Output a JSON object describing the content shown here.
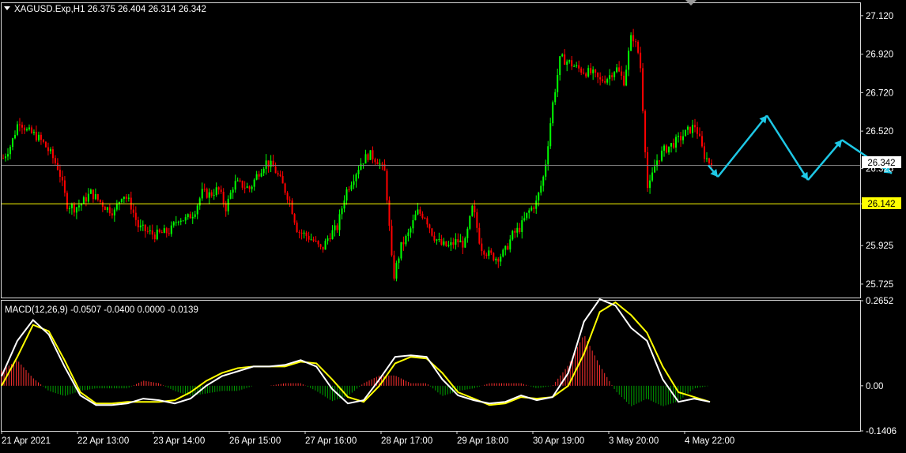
{
  "main_panel": {
    "header": "XAGUSD.Exp,H1  26.375 26.404 26.314 26.342",
    "current_price_label": "26.342",
    "level_label": "26.142",
    "colors": {
      "background": "#000000",
      "bull_candle": "#00ff00",
      "bear_candle": "#ff0000",
      "level_line": "#ffff00",
      "bid_line": "#808080",
      "arrows": "#1ec8e6",
      "axis_text": "#ffffff"
    }
  },
  "macd_panel": {
    "header": "MACD(12,26,9) -0.0507 -0.0400 0.0000 -0.0139",
    "colors": {
      "macd_line": "#ffffff",
      "signal_line": "#ffff00",
      "hist_positive": "#ff3030",
      "hist_negative": "#00a000"
    }
  },
  "chart_data": [
    {
      "type": "candlestick",
      "symbol": "XAGUSD.Exp",
      "timeframe": "H1",
      "ohlc_last": {
        "open": 26.375,
        "high": 26.404,
        "low": 26.314,
        "close": 26.342
      },
      "y_ticks": [
        "27.120",
        "26.920",
        "26.720",
        "26.520",
        "26.325",
        "26.142",
        "25.925",
        "25.725"
      ],
      "ylim": [
        25.655,
        27.185
      ],
      "horizontal_level": 26.142,
      "current_price": 26.342,
      "x_ticks": [
        "21 Apr 2021",
        "22 Apr 13:00",
        "23 Apr 14:00",
        "26 Apr 15:00",
        "27 Apr 16:00",
        "28 Apr 17:00",
        "29 Apr 18:00",
        "30 Apr 19:00",
        "3 May 20:00",
        "4 May 22:00"
      ],
      "close_path": [
        26.38,
        26.45,
        26.58,
        26.52,
        26.5,
        26.46,
        26.4,
        26.32,
        26.14,
        26.12,
        26.15,
        26.2,
        26.16,
        26.12,
        26.1,
        26.2,
        26.14,
        26.02,
        26.0,
        25.98,
        25.99,
        26.0,
        26.07,
        26.06,
        26.1,
        26.2,
        26.19,
        26.22,
        26.12,
        26.25,
        26.24,
        26.22,
        26.3,
        26.36,
        26.33,
        26.25,
        26.16,
        26.0,
        25.98,
        25.95,
        25.9,
        25.98,
        26.02,
        26.2,
        26.28,
        26.36,
        26.4,
        26.37,
        26.3,
        25.75,
        25.92,
        25.99,
        26.1,
        26.08,
        25.98,
        25.93,
        25.92,
        25.95,
        25.93,
        26.13,
        25.92,
        25.88,
        25.86,
        25.89,
        25.98,
        26.02,
        26.1,
        26.15,
        26.3,
        26.65,
        26.9,
        26.88,
        26.85,
        26.83,
        26.82,
        26.78,
        26.8,
        26.85,
        26.78,
        27.03,
        26.9,
        26.2,
        26.36,
        26.42,
        26.45,
        26.48,
        26.52,
        26.55,
        26.4,
        26.342
      ],
      "forecast_arrows": [
        [
          26.342,
          26.282
        ],
        [
          26.282,
          26.601
        ],
        [
          26.601,
          26.266
        ],
        [
          26.266,
          26.474
        ],
        [
          26.474,
          26.3
        ]
      ]
    },
    {
      "type": "macd",
      "params": "12,26,9",
      "values_shown": [
        -0.0507,
        -0.04,
        0.0,
        -0.0139
      ],
      "y_ticks": [
        "0.2652",
        "0.00",
        "-0.1406"
      ],
      "ylim": [
        -0.1406,
        0.2652
      ],
      "macd_series": [
        0.03,
        0.14,
        0.205,
        0.16,
        0.06,
        -0.03,
        -0.06,
        -0.06,
        -0.055,
        -0.04,
        -0.045,
        -0.055,
        -0.04,
        0.0,
        0.03,
        0.045,
        0.06,
        0.06,
        0.065,
        0.08,
        0.06,
        -0.01,
        -0.055,
        -0.045,
        0.02,
        0.09,
        0.095,
        0.09,
        0.02,
        -0.03,
        -0.045,
        -0.055,
        -0.05,
        -0.03,
        -0.045,
        -0.035,
        0.04,
        0.2,
        0.27,
        0.25,
        0.18,
        0.14,
        0.02,
        -0.05,
        -0.04,
        -0.05
      ],
      "signal_series": [
        0.0,
        0.09,
        0.19,
        0.17,
        0.08,
        -0.02,
        -0.055,
        -0.055,
        -0.05,
        -0.05,
        -0.05,
        -0.045,
        -0.02,
        0.015,
        0.04,
        0.055,
        0.06,
        0.06,
        0.06,
        0.075,
        0.07,
        0.02,
        -0.035,
        -0.05,
        0.0,
        0.07,
        0.09,
        0.085,
        0.04,
        -0.02,
        -0.04,
        -0.06,
        -0.055,
        -0.035,
        -0.04,
        -0.035,
        0.0,
        0.1,
        0.23,
        0.26,
        0.22,
        0.165,
        0.06,
        -0.02,
        -0.035,
        -0.05
      ]
    }
  ]
}
